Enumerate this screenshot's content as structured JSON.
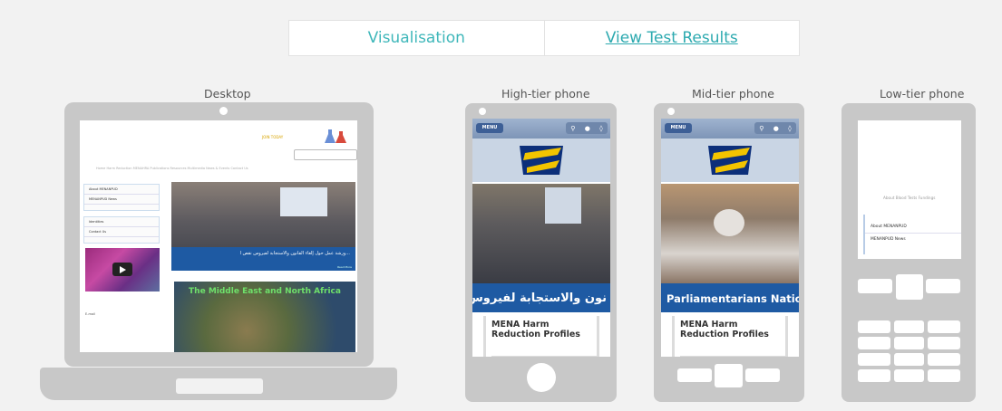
{
  "tabs": {
    "visualisation": "Visualisation",
    "results": "View Test Results"
  },
  "devices": {
    "desktop": "Desktop",
    "high": "High-tier phone",
    "mid": "Mid-tier phone",
    "low": "Low-tier phone"
  },
  "desktop_site": {
    "header_button": "JOIN TODAY",
    "nav": "Home  Harm Reduction  MENAHRA Publications  Resources  Multimedia  News & Events  Contact Us",
    "side1": [
      "About MENANPUD",
      "MENANPUD News"
    ],
    "side2": [
      "Identities",
      "Contact Us"
    ],
    "small_text": "E-mail",
    "hero_caption": "...ورشة عمل حول إلغاء القانون والاستجابة لفيروس نقص ا",
    "hero_credit": "Read More",
    "map_title": "The Middle East and North Africa"
  },
  "high_phone": {
    "menu": "MENU",
    "bar_text": "نون والاستجابة لفيروس نقص ا",
    "card": "MENA Harm Reduction Profiles"
  },
  "mid_phone": {
    "menu": "MENU",
    "bar_text": "Parliamentarians National (",
    "card": "MENA Harm Reduction Profiles"
  },
  "low_phone": {
    "nav": "About  Blood Tests Fundings",
    "items": [
      "About MENANPUD",
      "MENANPUD News"
    ]
  },
  "colors": {
    "accent": "#3fb7ba",
    "device": "#c8c8c8",
    "site_blue": "#1e5aa3"
  }
}
